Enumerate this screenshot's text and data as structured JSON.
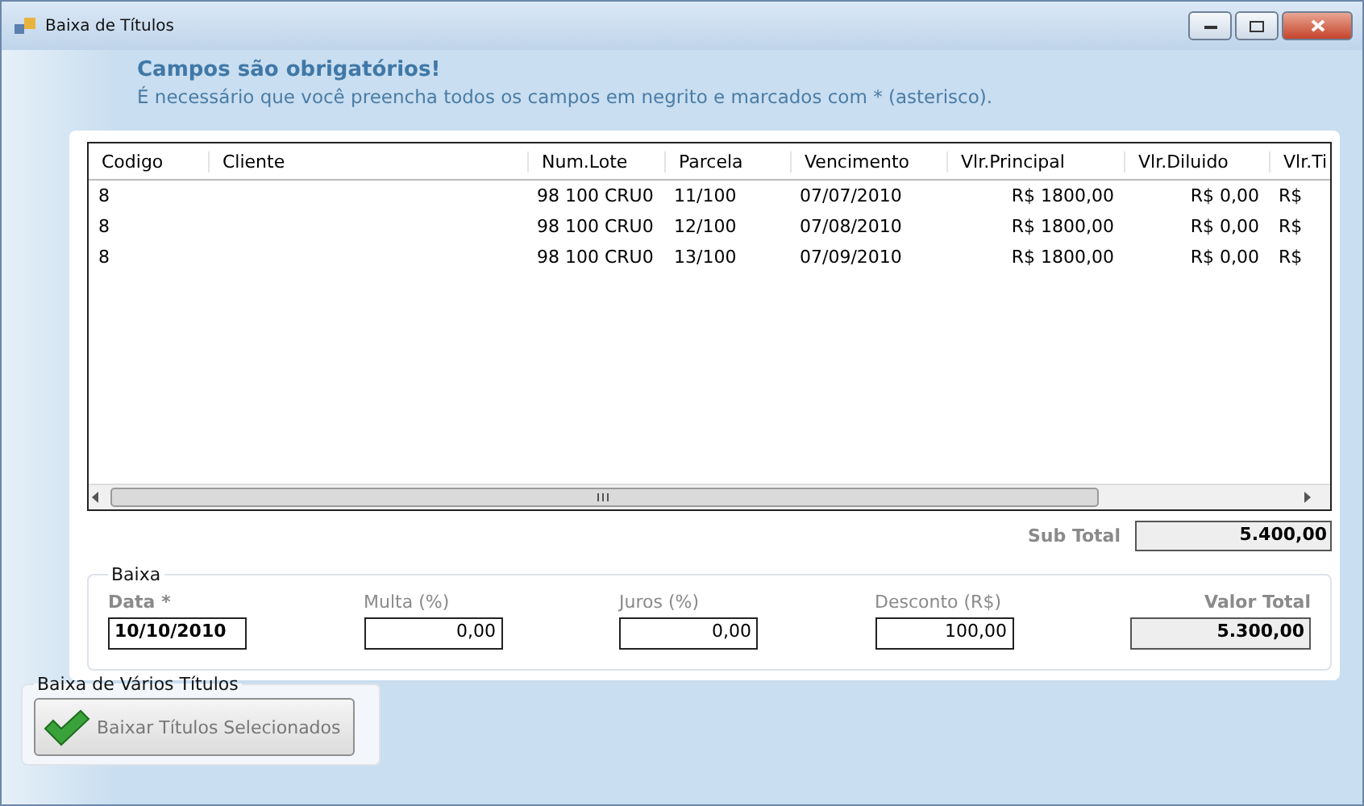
{
  "window": {
    "title": "Baixa de Títulos"
  },
  "notice": {
    "title": "Campos são obrigatórios!",
    "text": "É necessário que você preencha todos os campos em negrito e marcados com * (asterisco)."
  },
  "table": {
    "columns": [
      "Codigo",
      "Cliente",
      "Num.Lote",
      "Parcela",
      "Vencimento",
      "Vlr.Principal",
      "Vlr.Diluido",
      "Vlr.Ti"
    ],
    "rows": [
      [
        "8",
        "",
        "98 100 CRU0",
        "11/100",
        "07/07/2010",
        "R$ 1800,00",
        "R$ 0,00",
        "R$"
      ],
      [
        "8",
        "",
        "98 100 CRU0",
        "12/100",
        "07/08/2010",
        "R$ 1800,00",
        "R$ 0,00",
        "R$"
      ],
      [
        "8",
        "",
        "98 100 CRU0",
        "13/100",
        "07/09/2010",
        "R$ 1800,00",
        "R$ 0,00",
        "R$"
      ]
    ]
  },
  "subtotal": {
    "label": "Sub Total",
    "value": "5.400,00"
  },
  "baixa": {
    "title": "Baixa",
    "fields": [
      {
        "label": "Data *",
        "value": "10/10/2010",
        "required": true,
        "kind": "input"
      },
      {
        "label": "Multa (%)",
        "value": "0,00",
        "required": false,
        "kind": "input"
      },
      {
        "label": "Juros (%)",
        "value": "0,00",
        "required": false,
        "kind": "input"
      },
      {
        "label": "Desconto (R$)",
        "value": "100,00",
        "required": false,
        "kind": "input"
      },
      {
        "label": "Valor Total",
        "value": "5.300,00",
        "required": true,
        "kind": "readonly"
      }
    ]
  },
  "batch": {
    "title": "Baixa de Vários Títulos",
    "button": "Baixar Títulos Selecionados"
  }
}
